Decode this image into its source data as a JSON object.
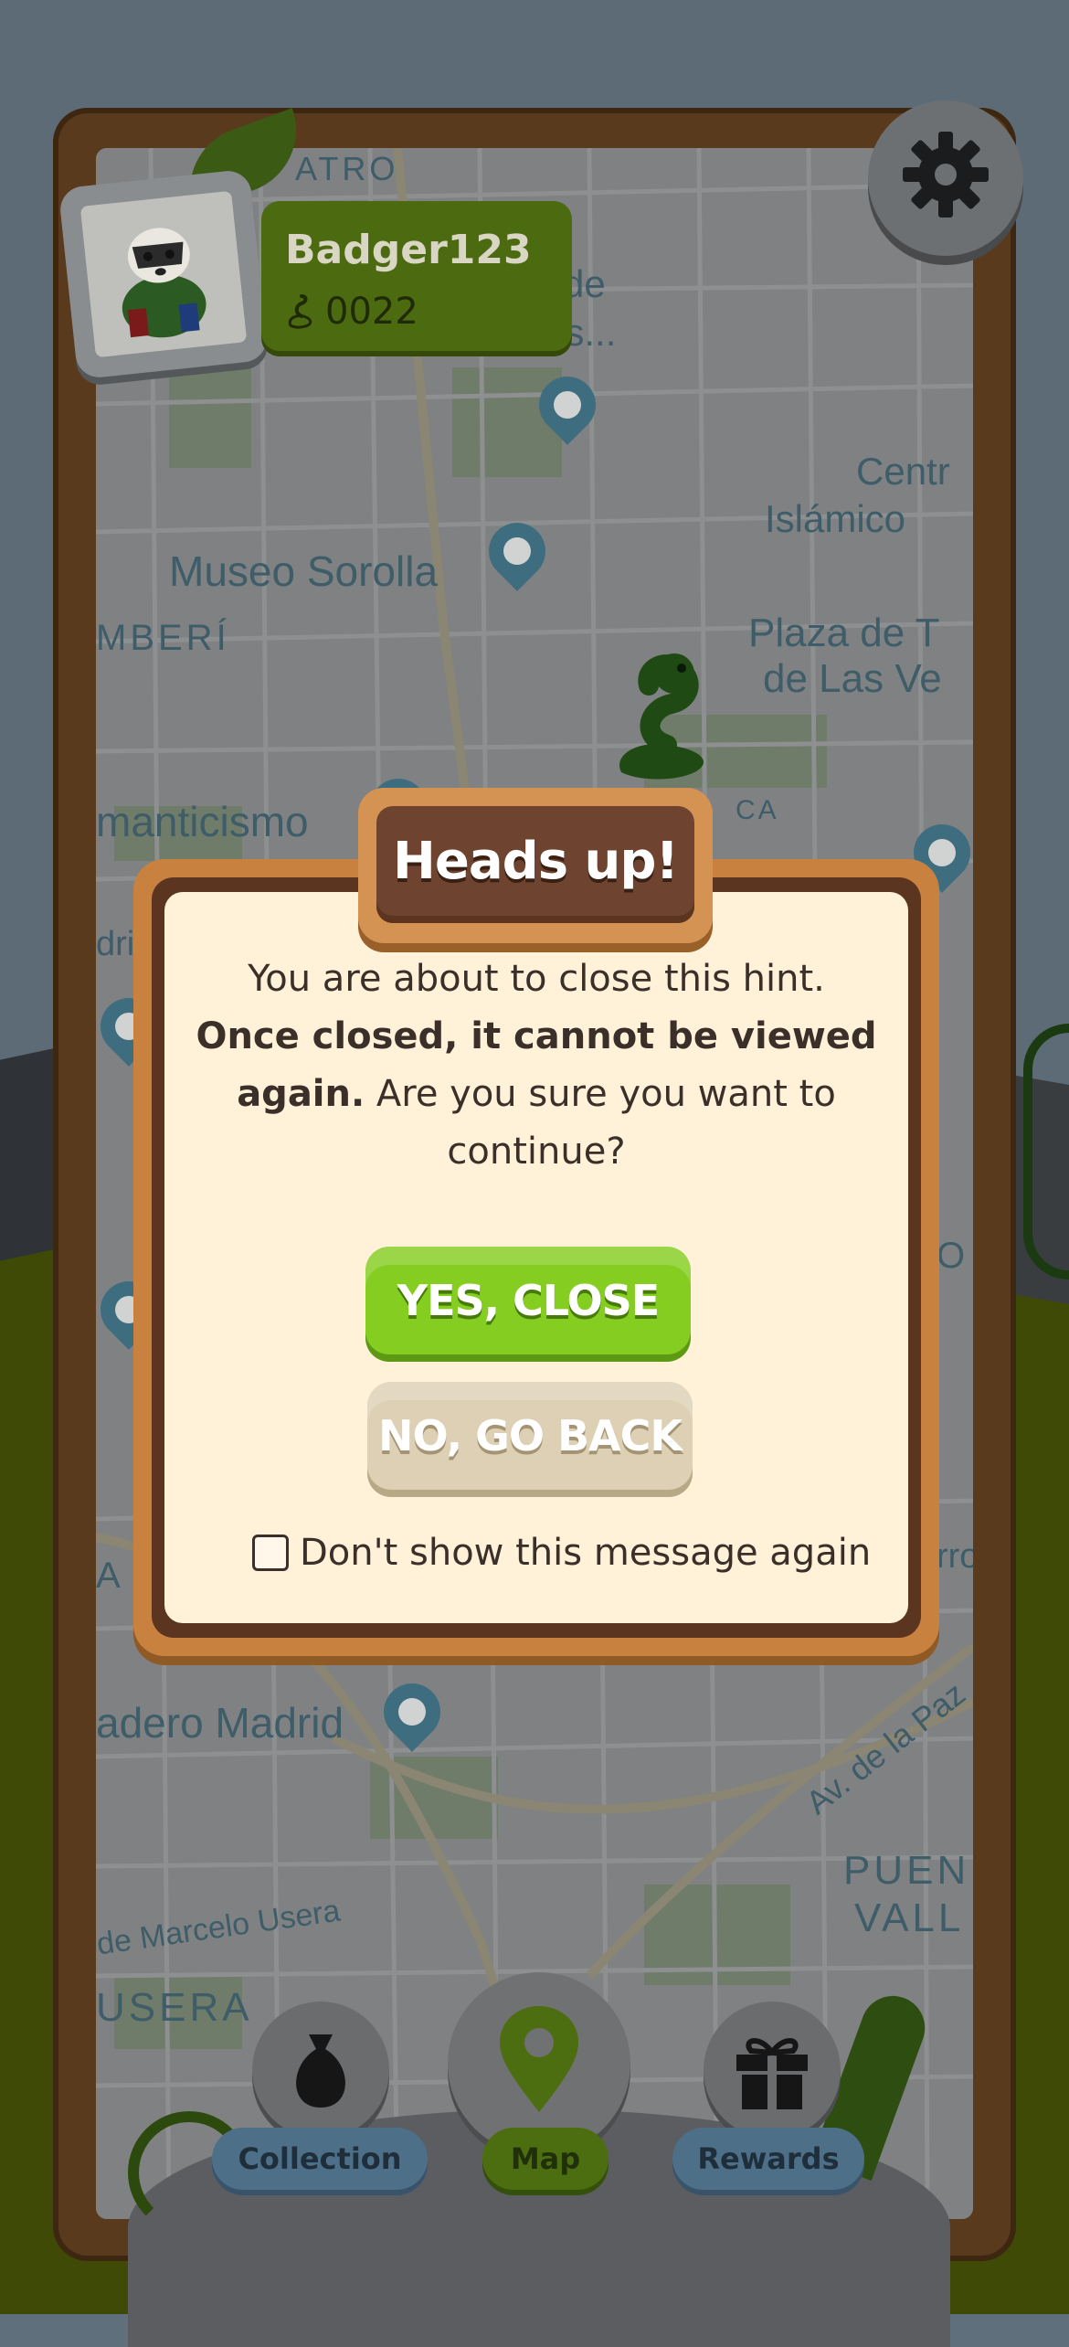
{
  "player": {
    "name": "Badger123",
    "coins": "0022",
    "avatar_icon": "badger-avatar-icon",
    "coin_icon": "snake-coin-icon"
  },
  "settings": {
    "icon": "gear-icon"
  },
  "map": {
    "labels": {
      "teatro": "ATRO",
      "museo_de_1": "l de",
      "museo_de_2": "es...",
      "centro_islamico_1": "Centr",
      "centro_islamico_2": "Islámico",
      "museo_sorolla": "Museo Sorolla",
      "chamberi": "MBERÍ",
      "plaza_1": "Plaza de T",
      "plaza_2": "de Las Ve",
      "romanticismo": "manticismo",
      "ca": "CA",
      "matadero": "adero Madrid",
      "av_paz": "Av. de la Paz",
      "marcelo_usera": "de Marcelo Usera",
      "usera": "USERA",
      "puente_1": "PUEN",
      "puente_2": "VALL",
      "a_left": "A",
      "dri": "dri",
      "o_right": "O",
      "rro": "rro"
    }
  },
  "dialog": {
    "title": "Heads up!",
    "message_line1": "You are about to close this hint.",
    "message_bold": "Once closed, it cannot be viewed again.",
    "message_rest": " Are you sure you want to continue?",
    "confirm_label": "YES, CLOSE",
    "cancel_label": "NO, GO BACK",
    "dont_show_label": "Don't show this message again",
    "dont_show_checked": false
  },
  "nav": {
    "collection_label": "Collection",
    "map_label": "Map",
    "rewards_label": "Rewards",
    "collection_icon": "bag-icon",
    "map_icon": "map-pin-icon",
    "rewards_icon": "gift-icon",
    "active": "Map"
  },
  "colors": {
    "confirm": "#86cd22",
    "cancel": "#ddd0b4",
    "dialog_bg": "#fff2d8",
    "frame": "#5a3a1d"
  }
}
